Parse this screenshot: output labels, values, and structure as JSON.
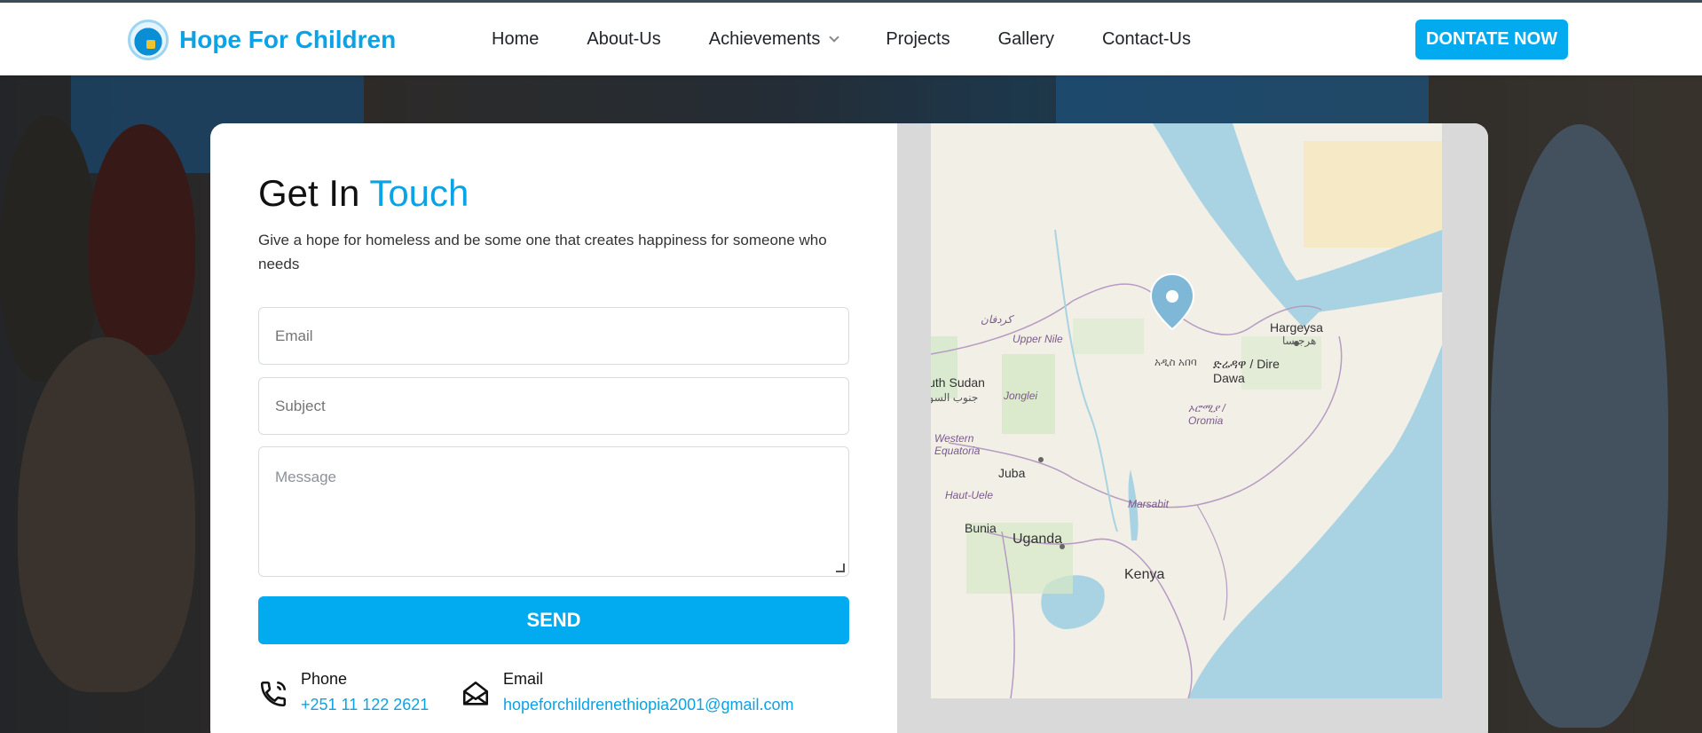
{
  "brand": {
    "name": "Hope For Children"
  },
  "nav": {
    "items": [
      {
        "label": "Home"
      },
      {
        "label": "About-Us"
      },
      {
        "label": "Achievements"
      },
      {
        "label": "Projects"
      },
      {
        "label": "Gallery"
      },
      {
        "label": "Contact-Us"
      }
    ],
    "donate_label": "DONTATE NOW"
  },
  "contact_form": {
    "title_plain": "Get In",
    "title_accent": "Touch",
    "subtitle": "Give a hope for homeless and be some one that creates happiness for someone who needs",
    "email_placeholder": "Email",
    "subject_placeholder": "Subject",
    "message_placeholder": "Message",
    "send_label": "SEND"
  },
  "contact_info": {
    "phone_label": "Phone",
    "phone_value": "+251 11 122 2621",
    "email_label": "Email",
    "email_value": "hopeforchildrenethiopia2001@gmail.com"
  },
  "map": {
    "labels": [
      "Hargeysa",
      "هرجيسا",
      "ድሬዳዋ / Dire Dawa",
      "South Sudan",
      "جنوب السودان",
      "Upper Nile",
      "Jonglei",
      "Western Equatoria",
      "Juba",
      "Haut-Uele",
      "Bunia",
      "Uganda",
      "Kenya",
      "Marsabit",
      "ኦሮሚያ / Oromia",
      "كردفان",
      "አዲስ አበባ"
    ]
  },
  "colors": {
    "accent": "#0aa3e6",
    "button": "#02aaf0",
    "nav_bg": "#ffffff"
  }
}
